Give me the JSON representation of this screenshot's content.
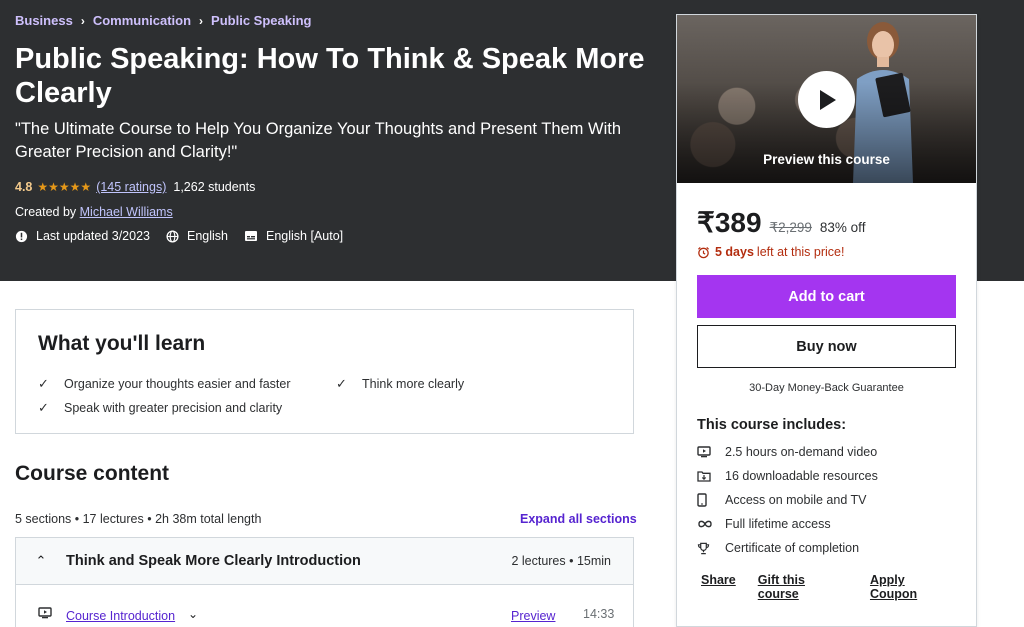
{
  "breadcrumb": [
    "Business",
    "Communication",
    "Public Speaking"
  ],
  "course": {
    "title": "Public Speaking: How To Think & Speak More Clearly",
    "subtitle": "\"The Ultimate Course to Help You Organize Your Thoughts and Present Them With Greater Precision and Clarity!\"",
    "rating": "4.8",
    "stars": "★★★★★",
    "rating_count": "(145 ratings)",
    "students": "1,262 students",
    "created_by_label": "Created by",
    "instructor": "Michael Williams",
    "last_updated": "Last updated 3/2023",
    "language": "English",
    "captions": "English [Auto]"
  },
  "learn": {
    "title": "What you'll learn",
    "items": [
      "Organize your thoughts easier and faster",
      "Think more clearly",
      "Speak with greater precision and clarity"
    ]
  },
  "content": {
    "title": "Course content",
    "meta": "5 sections • 17 lectures • 2h 38m total length",
    "expand_label": "Expand all sections",
    "section": {
      "title": "Think and Speak More Clearly Introduction",
      "info": "2 lectures • 15min"
    },
    "lecture": {
      "title": "Course Introduction",
      "preview": "Preview",
      "duration": "14:33"
    }
  },
  "sidebar": {
    "preview_label": "Preview this course",
    "price": "₹389",
    "old_price": "₹2,299",
    "discount": "83% off",
    "timer_bold": "5 days",
    "timer_rest": "left at this price!",
    "cart_label": "Add to cart",
    "buy_label": "Buy now",
    "guarantee": "30-Day Money-Back Guarantee",
    "includes_title": "This course includes:",
    "includes": [
      {
        "icon": "video-icon",
        "label": "2.5 hours on-demand video"
      },
      {
        "icon": "download-icon",
        "label": "16 downloadable resources"
      },
      {
        "icon": "mobile-icon",
        "label": "Access on mobile and TV"
      },
      {
        "icon": "infinity-icon",
        "label": "Full lifetime access"
      },
      {
        "icon": "trophy-icon",
        "label": "Certificate of completion"
      }
    ],
    "links": [
      "Share",
      "Gift this course",
      "Apply Coupon"
    ]
  },
  "colors": {
    "hero_bg": "#2d2f31",
    "accent_purple": "#a435f0",
    "link_purple": "#5624d0",
    "star_gold": "#e59819",
    "timer_red": "#b32d0f"
  }
}
